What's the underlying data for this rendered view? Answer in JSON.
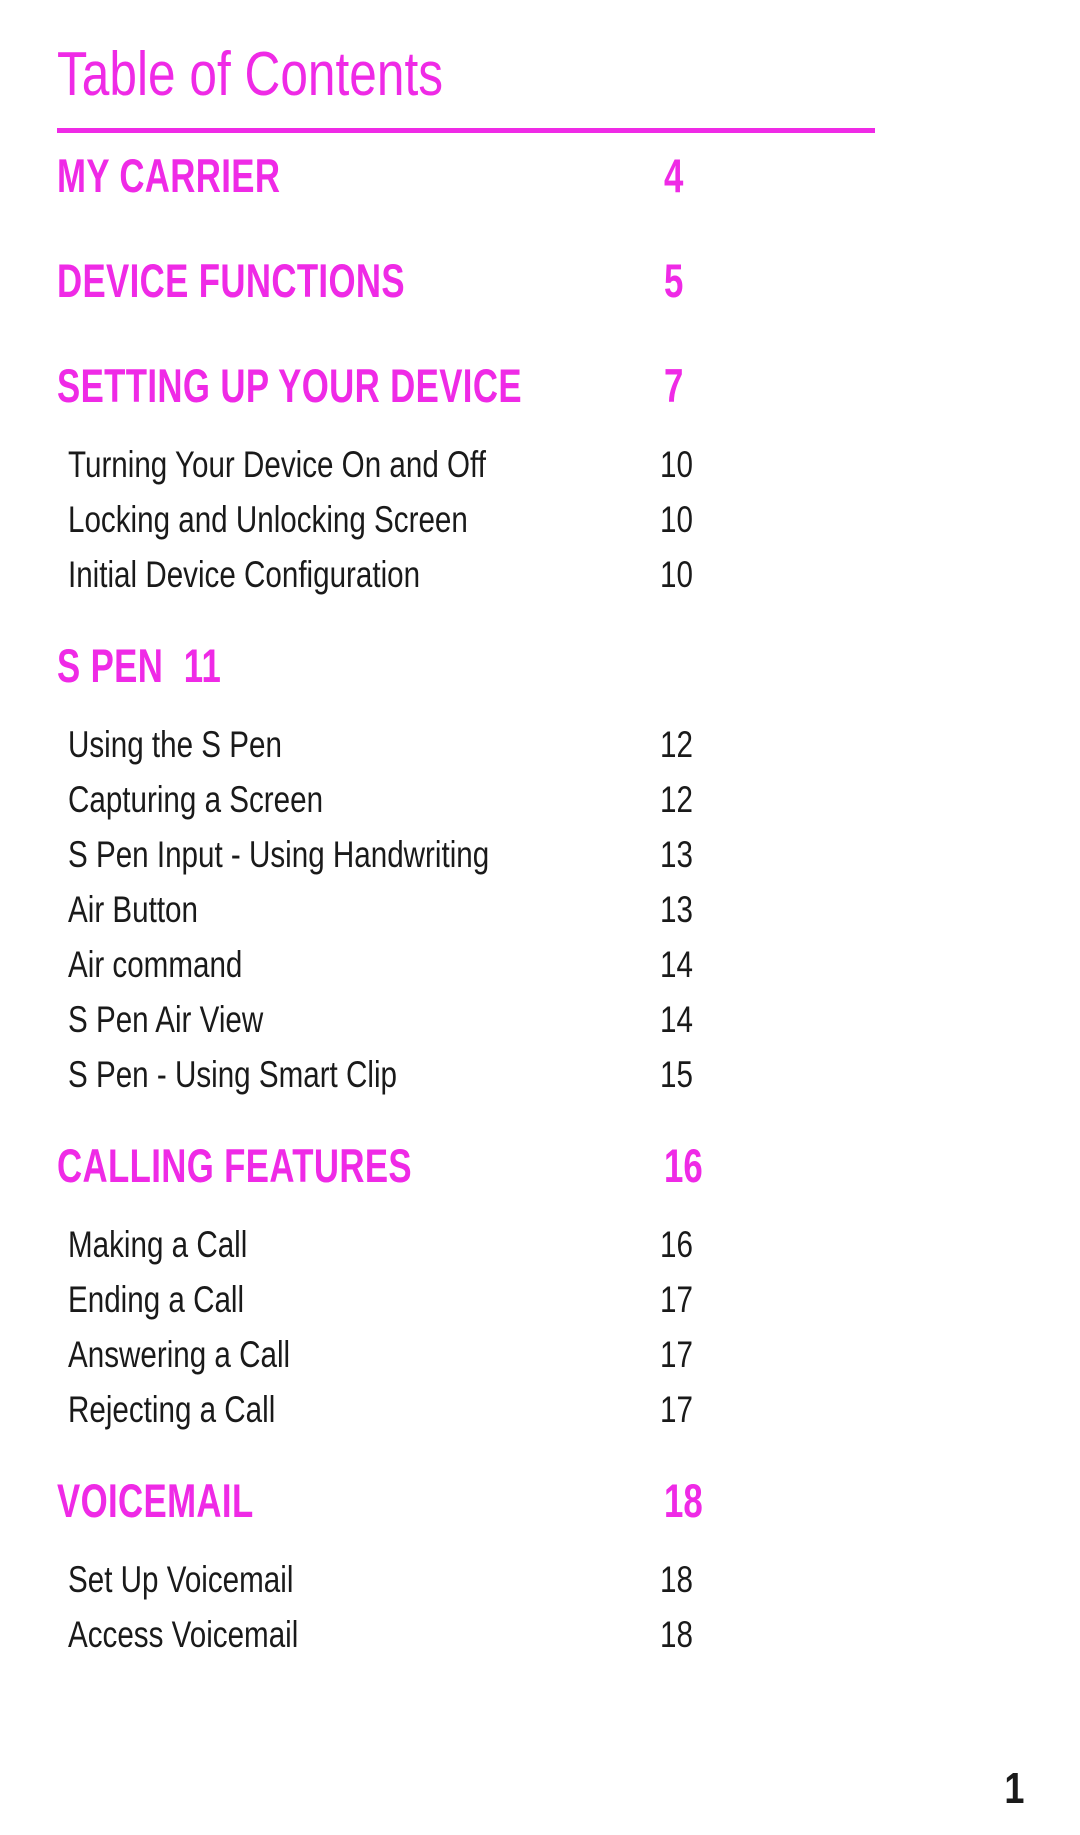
{
  "document": {
    "title": "Table of Contents",
    "footer_page_number": "1",
    "accent_color": "#ef2ae6",
    "text_color": "#1a1a1a"
  },
  "toc": {
    "entries": [
      {
        "kind": "section",
        "label": "MY CARRIER",
        "page": "4"
      },
      {
        "kind": "section",
        "label": "DEVICE FUNCTIONS",
        "page": "5"
      },
      {
        "kind": "section",
        "label": "SETTING UP YOUR DEVICE",
        "page": "7"
      },
      {
        "kind": "entry",
        "label": "Turning Your Device On and Off",
        "page": "10"
      },
      {
        "kind": "entry",
        "label": "Locking and Unlocking Screen",
        "page": "10"
      },
      {
        "kind": "entry",
        "label": "Initial Device Configuration",
        "page": "10"
      },
      {
        "kind": "section-inline",
        "label": "S PEN",
        "page": "11"
      },
      {
        "kind": "entry",
        "label": "Using the S Pen",
        "page": "12"
      },
      {
        "kind": "entry",
        "label": "Capturing a Screen",
        "page": "12"
      },
      {
        "kind": "entry",
        "label": "S Pen Input - Using Handwriting",
        "page": "13"
      },
      {
        "kind": "entry",
        "label": "Air Button",
        "page": "13"
      },
      {
        "kind": "entry",
        "label": "Air command",
        "page": "14"
      },
      {
        "kind": "entry",
        "label": "S Pen Air View",
        "page": "14"
      },
      {
        "kind": "entry",
        "label": "S Pen - Using Smart Clip",
        "page": "15"
      },
      {
        "kind": "section",
        "label": "CALLING FEATURES",
        "page": "16"
      },
      {
        "kind": "entry",
        "label": "Making a Call",
        "page": "16"
      },
      {
        "kind": "entry",
        "label": "Ending a Call",
        "page": "17"
      },
      {
        "kind": "entry",
        "label": "Answering a Call",
        "page": "17"
      },
      {
        "kind": "entry",
        "label": "Rejecting a Call",
        "page": "17"
      },
      {
        "kind": "section",
        "label": "VOICEMAIL",
        "page": "18"
      },
      {
        "kind": "entry",
        "label": "Set Up Voicemail",
        "page": "18"
      },
      {
        "kind": "entry",
        "label": "Access Voicemail",
        "page": "18"
      }
    ]
  }
}
